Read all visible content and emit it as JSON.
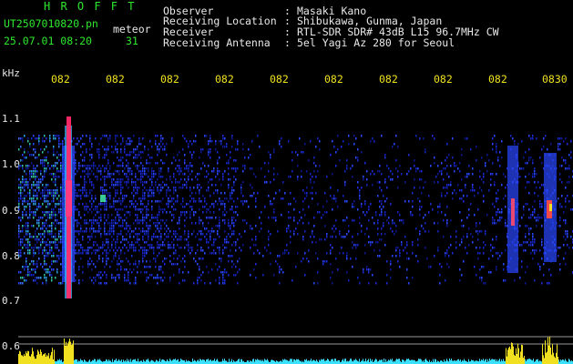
{
  "app": {
    "brand": "H R O F F T",
    "filename": "UT2507010820.png",
    "filename_shown": "UT2507010820.pn",
    "tag": "meteor",
    "datetime": "25.07.01 08:20",
    "count": "31"
  },
  "info": {
    "rows": [
      {
        "label": "Observer",
        "value": "Masaki Kano"
      },
      {
        "label": "Receiving Location",
        "value": "Shibukawa, Gunma, Japan"
      },
      {
        "label": "Receiver",
        "value": "RTL-SDR SDR# 43dB L15 96.7MHz CW"
      },
      {
        "label": "Receiving Antenna",
        "value": "5el Yagi Az 280 for Seoul"
      }
    ],
    "separator": ":"
  },
  "axis": {
    "y_unit": "kHz",
    "y_ticks": [
      "1.1",
      "1.0",
      "0.9",
      "0.8",
      "0.7",
      "0.6"
    ],
    "x_ticks": [
      "082",
      "082",
      "082",
      "082",
      "082",
      "082",
      "082",
      "082",
      "082",
      "0830"
    ]
  },
  "colors": {
    "green": "#2ee82e",
    "yellow": "#f0e020",
    "background": "#000000",
    "noise_blue": "#1c2ad8",
    "hot": "#ff2a6a",
    "power_cyan": "#3ce0ff"
  }
}
